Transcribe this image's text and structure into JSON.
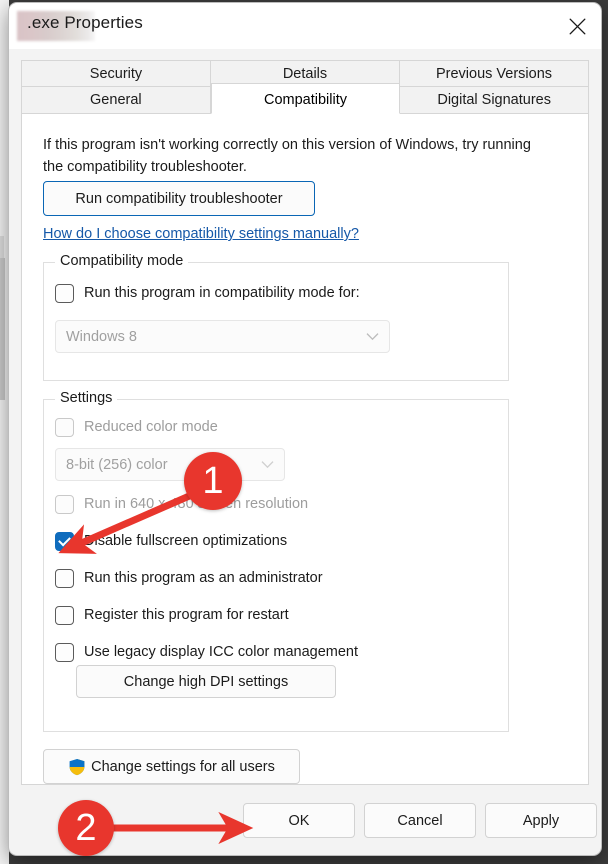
{
  "window": {
    "title_suffix": ".exe Properties",
    "filename_redacted": true,
    "close_label": "Close"
  },
  "tabs": {
    "row1": [
      {
        "label": "Security",
        "selected": false
      },
      {
        "label": "Details",
        "selected": false
      },
      {
        "label": "Previous Versions",
        "selected": false
      }
    ],
    "row2": [
      {
        "label": "General",
        "selected": false
      },
      {
        "label": "Compatibility",
        "selected": true
      },
      {
        "label": "Digital Signatures",
        "selected": false
      }
    ]
  },
  "compatibility_page": {
    "intro_text": "If this program isn't working correctly on this version of Windows, try running the compatibility troubleshooter.",
    "troubleshooter_button": "Run compatibility troubleshooter",
    "help_link": "How do I choose compatibility settings manually?",
    "compatibility_mode_group": {
      "title": "Compatibility mode",
      "checkbox_label": "Run this program in compatibility mode for:",
      "checkbox_checked": false,
      "checkbox_disabled": false,
      "combo_value": "Windows 8",
      "combo_disabled": true
    },
    "settings_group": {
      "title": "Settings",
      "items": [
        {
          "label": "Reduced color mode",
          "checked": false,
          "disabled": true
        },
        {
          "label": "Run in 640 x 480 screen resolution",
          "checked": false,
          "disabled": true
        },
        {
          "label": "Disable fullscreen optimizations",
          "checked": true,
          "disabled": false
        },
        {
          "label": "Run this program as an administrator",
          "checked": false,
          "disabled": false
        },
        {
          "label": "Register this program for restart",
          "checked": false,
          "disabled": false
        },
        {
          "label": "Use legacy display ICC color management",
          "checked": false,
          "disabled": false
        }
      ],
      "color_combo_value": "8-bit (256) color",
      "color_combo_disabled": true,
      "dpi_button": "Change high DPI settings"
    },
    "change_all_users_button": "Change settings for all users"
  },
  "footer": {
    "ok": "OK",
    "cancel": "Cancel",
    "apply": "Apply"
  },
  "annotations": {
    "accent_color": "#e8362d",
    "markers": [
      {
        "number": "1",
        "points_to": "Disable fullscreen optimizations checkbox"
      },
      {
        "number": "2",
        "points_to": "OK button"
      }
    ]
  },
  "colors": {
    "dialog_background": "#f3f3f3",
    "page_background": "#ffffff",
    "checkbox_accent": "#0f6cbd",
    "link": "#1558a8",
    "annotation_red": "#e8362d"
  }
}
